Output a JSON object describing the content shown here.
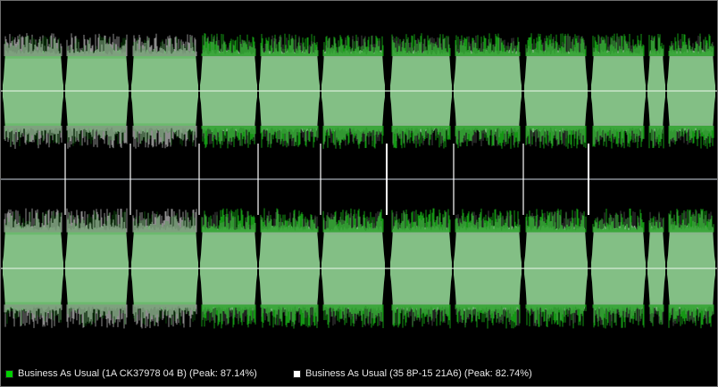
{
  "colors": {
    "background": "#000000",
    "track_a": "#00d000",
    "track_b": "#ffffff",
    "wave_fill": "#83bf85",
    "wave_peak_green": "#18a818",
    "wave_peak_gray": "#9c9c9c",
    "center_line": "#d6ecd6",
    "divider": "#8a8f98",
    "marker": "#ffffff"
  },
  "legend": [
    {
      "label": "Business As Usual (1A CK37978 04 B) (Peak: 87.14%)",
      "color": "#00d000",
      "swatch_icon": "green-square-icon"
    },
    {
      "label": "Business As Usual (35 8P-15 21A6) (Peak: 82.74%)",
      "color": "#ffffff",
      "swatch_icon": "white-square-icon"
    }
  ]
}
